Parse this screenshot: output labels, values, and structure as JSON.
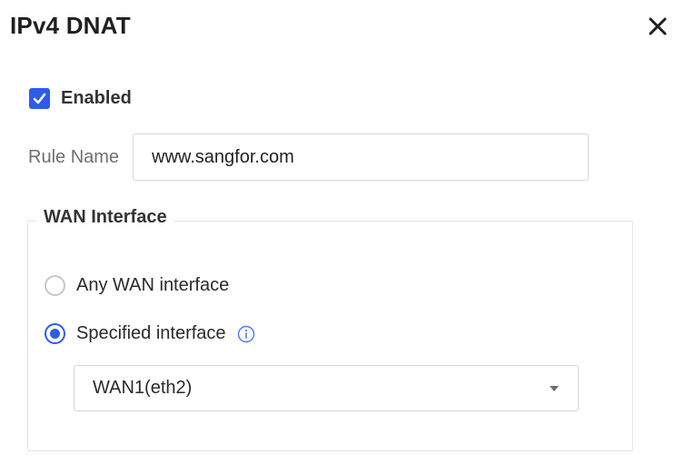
{
  "dialog": {
    "title": "IPv4 DNAT",
    "close_icon": "close-icon"
  },
  "enabled": {
    "label": "Enabled",
    "checked": true
  },
  "rule_name": {
    "label": "Rule Name",
    "value": "www.sangfor.com"
  },
  "wan_interface": {
    "title": "WAN Interface",
    "options": [
      {
        "label": "Any WAN interface",
        "selected": false
      },
      {
        "label": "Specified interface",
        "selected": true
      }
    ],
    "info_icon": "info-icon",
    "selected_interface": "WAN1(eth2)"
  },
  "colors": {
    "accent": "#2f5bea",
    "border": "#d6d6d6",
    "label_muted": "#6f6f6f"
  }
}
